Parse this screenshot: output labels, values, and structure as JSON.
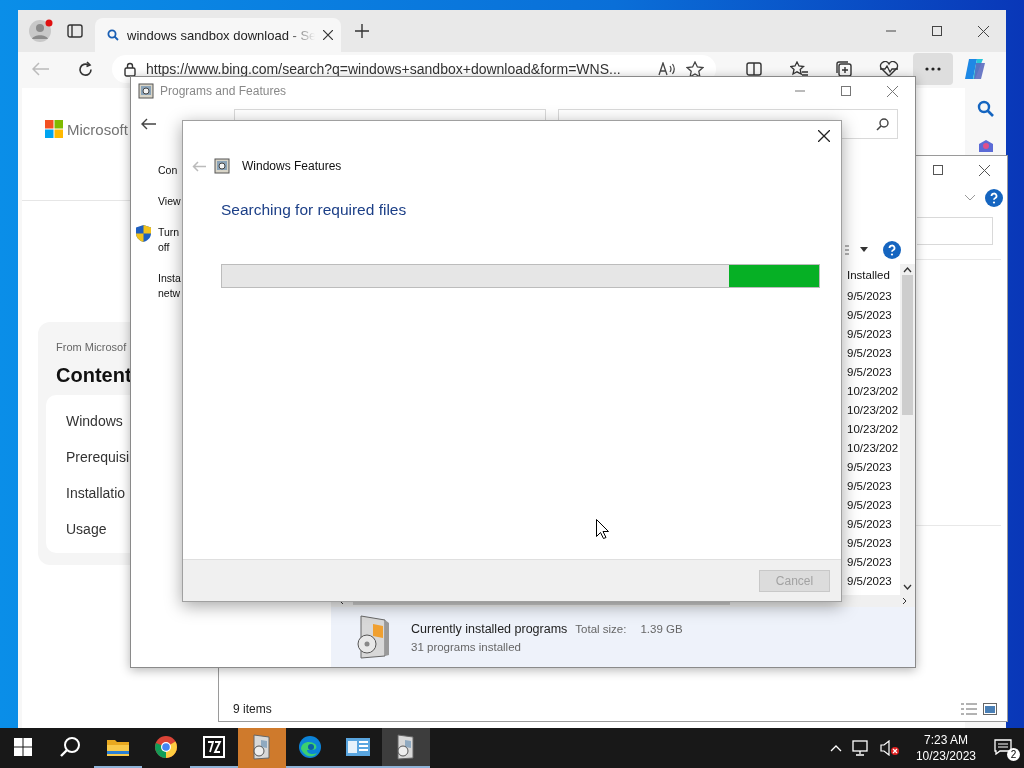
{
  "browser": {
    "tab": {
      "title": "windows sandbox download - Se",
      "selected": true
    },
    "url": "https://www.bing.com/search?q=windows+sandbox+download&form=WNS...",
    "logo": "Microsoft",
    "card": {
      "eyebrow": "From Microsof",
      "heading": "Content",
      "items": [
        "Windows",
        "Prerequisi",
        "Installatio",
        "Usage"
      ]
    }
  },
  "explorer": {
    "status": "9 items"
  },
  "programs": {
    "title": "Programs and Features",
    "side_links": [
      {
        "lines": [
          "Con"
        ],
        "shield": false
      },
      {
        "lines": [
          "View"
        ],
        "shield": false
      },
      {
        "lines": [
          "Turn",
          "off"
        ],
        "shield": true
      },
      {
        "lines": [
          "Insta",
          "netw"
        ],
        "shield": false
      }
    ],
    "column": "Installed",
    "dates": [
      "9/5/2023",
      "9/5/2023",
      "9/5/2023",
      "9/5/2023",
      "9/5/2023",
      "10/23/202",
      "10/23/202",
      "10/23/202",
      "10/23/202",
      "9/5/2023",
      "9/5/2023",
      "9/5/2023",
      "9/5/2023",
      "9/5/2023",
      "9/5/2023",
      "9/5/2023"
    ],
    "details": {
      "title": "Currently installed programs",
      "size_label": "Total size:",
      "size": "1.39 GB",
      "count": "31 programs installed"
    }
  },
  "dialog": {
    "title": "Windows Features",
    "heading": "Searching for required files",
    "cancel": {
      "label": "Cancel",
      "disabled": true
    }
  },
  "taskbar": {
    "apps": [
      {
        "kind": "folder",
        "running": true,
        "active": false,
        "flashing": false
      },
      {
        "kind": "chrome",
        "running": false,
        "active": false,
        "flashing": false
      },
      {
        "kind": "archiver",
        "running": true,
        "active": false,
        "flashing": false
      },
      {
        "kind": "installer",
        "running": true,
        "active": false,
        "flashing": true
      },
      {
        "kind": "edge",
        "running": true,
        "active": false,
        "flashing": false
      },
      {
        "kind": "panel",
        "running": true,
        "active": false,
        "flashing": false
      },
      {
        "kind": "installer",
        "running": true,
        "active": true,
        "flashing": false
      }
    ],
    "time": "7:23 AM",
    "date": "10/23/2023",
    "notifications": "2"
  }
}
